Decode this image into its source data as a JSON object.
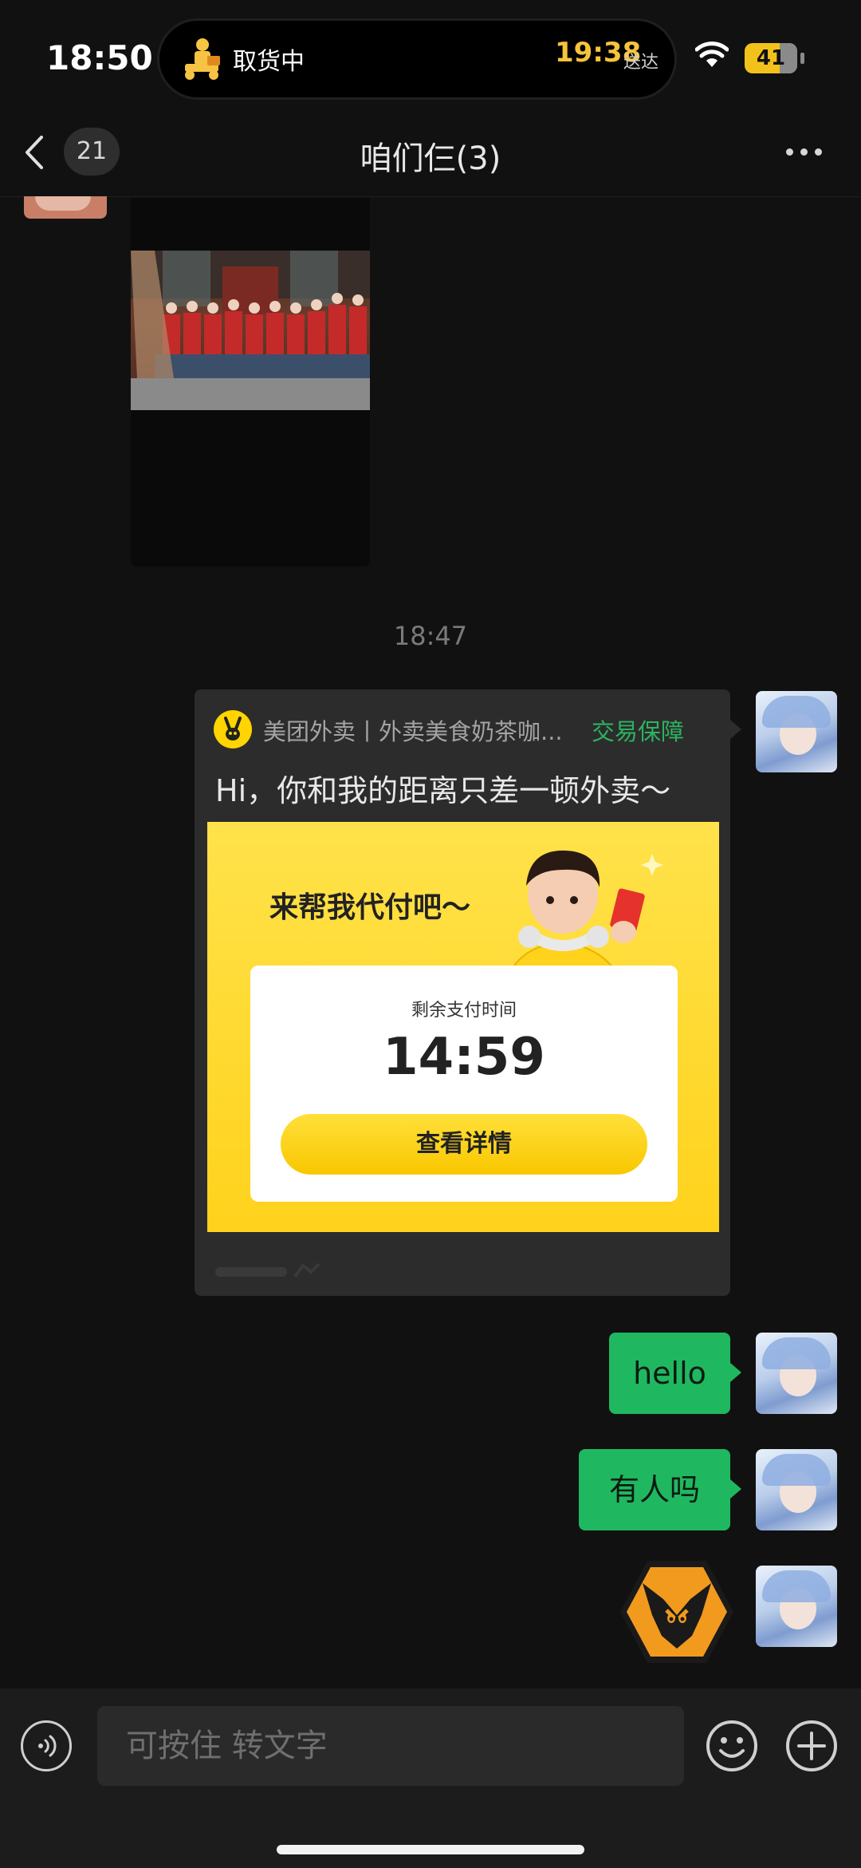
{
  "status_bar": {
    "time": "18:50",
    "live_activity": {
      "status": "取货中",
      "eta": "19:38",
      "eta_suffix": "送达",
      "icon": "courier-icon"
    },
    "battery": "41",
    "colors": {
      "eta": "#f7c33b",
      "battery": "#f2c21b"
    }
  },
  "nav": {
    "back_icon": "chevron-left-icon",
    "unread_count": "21",
    "title": "咱们仨(3)",
    "more_icon": "more-horizontal-icon"
  },
  "messages": {
    "time_divider": "18:47",
    "mini_program": {
      "app_name": "美团外卖丨外卖美食奶茶咖...",
      "badge": "交易保障",
      "text": "Hi，你和我的距离只差一顿外卖～",
      "banner_heading": "来帮我代付吧～",
      "countdown_label": "剩余支付时间",
      "countdown": "14:59",
      "button": "查看详情",
      "colors": {
        "badge": "#2bb361",
        "banner": "#ffd21c"
      }
    },
    "bubbles": [
      {
        "text": "hello"
      },
      {
        "text": "有人吗"
      }
    ],
    "sticker": "wolf-head-sticker",
    "bubble_color": "#1fb860"
  },
  "input_bar": {
    "placeholder": "可按住 转文字",
    "voice_icon": "voice-icon",
    "emoji_icon": "emoji-icon",
    "add_icon": "plus-icon"
  }
}
